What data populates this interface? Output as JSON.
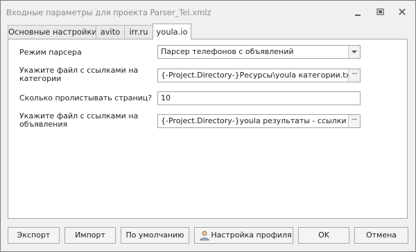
{
  "window": {
    "title": "Входные параметры для проекта Parser_Tel.xmlz"
  },
  "tabs": [
    {
      "label": "Основные настройки"
    },
    {
      "label": "avito"
    },
    {
      "label": "irr.ru"
    },
    {
      "label": "youla.io"
    }
  ],
  "form": {
    "parser_mode": {
      "label": "Режим парсера",
      "value": "Парсер телефонов с объявлений"
    },
    "categories_file": {
      "label": "Укажите файл с ссылками на категории",
      "value": "{-Project.Directory-}Ресурсы\\youla категории.txt"
    },
    "pages_count": {
      "label": "Сколько пролистывать страниц?",
      "value": "10"
    },
    "ads_file": {
      "label": "Укажите файл с ссылками на объявления",
      "value": "{-Project.Directory-}youla результаты - ссылки на объ"
    }
  },
  "buttons": {
    "export": "Экспорт",
    "import": "Импорт",
    "default": "По умолчанию",
    "profile": "Настройка профиля",
    "ok": "OK",
    "cancel": "Отмена"
  }
}
